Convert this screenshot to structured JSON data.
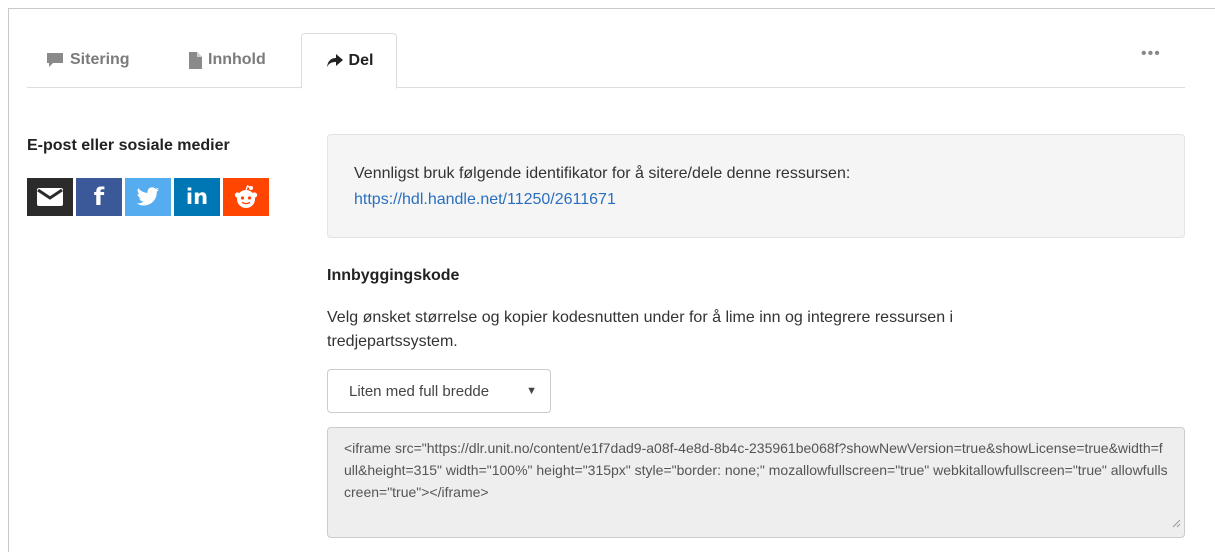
{
  "tabs": [
    {
      "label": "Sitering",
      "icon": "comment-icon"
    },
    {
      "label": "Innhold",
      "icon": "file-icon"
    },
    {
      "label": "Del",
      "icon": "share-arrow-icon",
      "active": true
    }
  ],
  "more_label": "•••",
  "share": {
    "heading": "E-post eller sosiale medier",
    "buttons": [
      {
        "name": "email",
        "icon": "envelope-icon",
        "color": "#2b2b2b"
      },
      {
        "name": "facebook",
        "icon": "facebook-icon",
        "glyph": "f",
        "color": "#3b5998"
      },
      {
        "name": "twitter",
        "icon": "twitter-icon",
        "color": "#55acee"
      },
      {
        "name": "linkedin",
        "icon": "linkedin-icon",
        "glyph": "in",
        "color": "#0077b5"
      },
      {
        "name": "reddit",
        "icon": "reddit-icon",
        "color": "#ff4500"
      }
    ]
  },
  "identifier": {
    "text": "Vennligst bruk følgende identifikator for å sitere/dele denne ressursen:",
    "link": "https://hdl.handle.net/11250/2611671"
  },
  "embed": {
    "heading": "Innbyggingskode",
    "description": "Velg ønsket størrelse og kopier kodesnutten under for å lime inn og integrere ressursen i tredjepartssystem.",
    "size_selected": "Liten med full bredde",
    "code": "<iframe src=\"https://dlr.unit.no/content/e1f7dad9-a08f-4e8d-8b4c-235961be068f?showNewVersion=true&showLicense=true&width=full&height=315\" width=\"100%\" height=\"315px\" style=\"border: none;\" mozallowfullscreen=\"true\" webkitallowfullscreen=\"true\" allowfullscreen=\"true\"></iframe>"
  },
  "colors": {
    "link": "#2a6fbf",
    "tab_inactive": "#7b7b7b",
    "info_box_bg": "#f5f5f5"
  }
}
